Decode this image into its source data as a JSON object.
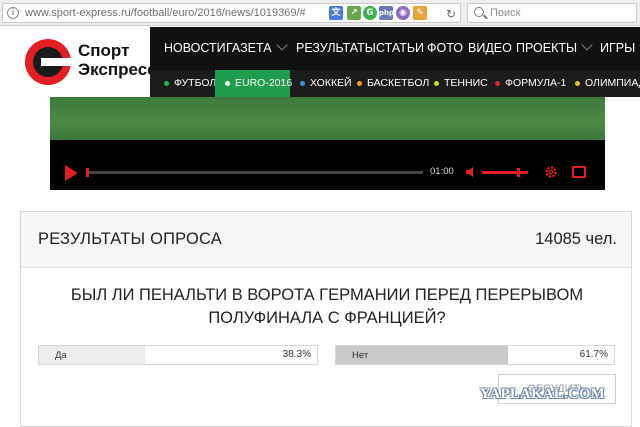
{
  "browser": {
    "url": "www.sport-express.ru/football/euro/2016/news/1019369/#",
    "search_placeholder": "Поиск",
    "extensions": [
      {
        "icon": "translate-icon",
        "color": "#4b7bd8"
      },
      {
        "icon": "chart-icon",
        "color": "#6aa84f"
      },
      {
        "icon": "grammarly-icon",
        "color": "#3bb34a"
      },
      {
        "icon": "php-icon",
        "color": "#6d78b8"
      },
      {
        "icon": "pocket-icon",
        "color": "#8e6bbf"
      },
      {
        "icon": "edit-icon",
        "color": "#e8a33c"
      }
    ]
  },
  "site": {
    "logo_line1": "Спорт",
    "logo_line2": "Экспресс",
    "nav": [
      "НОВОСТИ",
      "ГАЗЕТА",
      "РЕЗУЛЬТАТЫ",
      "СТАТЬИ",
      "ФОТО",
      "ВИДЕО",
      "ПРОЕКТЫ",
      "ИГРЫ"
    ],
    "subnav": [
      {
        "label": "ФУТБОЛ",
        "dot_color": "#2bb24c"
      },
      {
        "label": "EURO-2016",
        "dot_color": "#ffffff"
      },
      {
        "label": "ХОККЕЙ",
        "dot_color": "#3c8fd9"
      },
      {
        "label": "БАСКЕТБОЛ",
        "dot_color": "#f29b2b"
      },
      {
        "label": "ТЕННИС",
        "dot_color": "#c8d83a"
      },
      {
        "label": "ФОРМУЛА-1",
        "dot_color": "#e31e24"
      },
      {
        "label": "ОЛИМПИАДА",
        "dot_color": "#e8c234"
      }
    ],
    "accent_color": "#e31e24",
    "active_tab_color": "#1f9c4c"
  },
  "video": {
    "time": "01:00",
    "progress": 0.0,
    "volume": 0.8
  },
  "poll": {
    "title": "РЕЗУЛЬТАТЫ ОПРОСА",
    "count": "14085 чел.",
    "question": "БЫЛ ЛИ ПЕНАЛЬТИ В ВОРОТА ГЕРМАНИИ ПЕРЕД ПЕРЕРЫВОМ ПОЛУФИНАЛА С ФРАНЦИЕЙ?",
    "answers": [
      {
        "label": "Да",
        "percent": "38.3%",
        "share": 0.383
      },
      {
        "label": "Нет",
        "percent": "61.7%",
        "share": 0.617
      }
    ],
    "discuss_label": "ОБСУДИТЬ"
  },
  "watermark": "YAPLAKAL.COM"
}
